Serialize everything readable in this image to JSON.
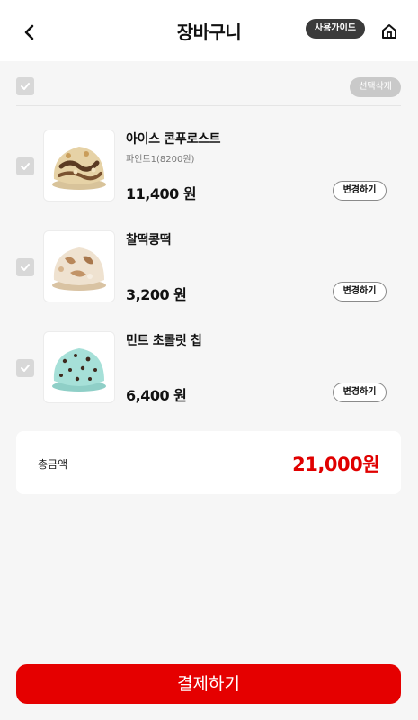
{
  "header": {
    "title": "장바구니",
    "guide_label": "사용가이드",
    "back_icon": "chevron-left-icon",
    "home_icon": "home-icon"
  },
  "select_bar": {
    "delete_selected_label": "선택삭제",
    "all_checked": true
  },
  "items": [
    {
      "name": "아이스 콘푸로스트",
      "option": "파인트1(8200원)",
      "price": "11,400 원",
      "change_label": "변경하기",
      "checked": true
    },
    {
      "name": "찰떡콩떡",
      "option": "",
      "price": "3,200 원",
      "change_label": "변경하기",
      "checked": true
    },
    {
      "name": "민트 초콜릿 칩",
      "option": "",
      "price": "6,400 원",
      "change_label": "변경하기",
      "checked": true
    }
  ],
  "summary": {
    "total_label": "총금액",
    "total_amount": "21,000원"
  },
  "footer": {
    "pay_label": "결제하기"
  },
  "colors": {
    "accent": "#e50000",
    "checkbox": "#d8d8d8",
    "guide_bg": "#3b3b3b"
  }
}
